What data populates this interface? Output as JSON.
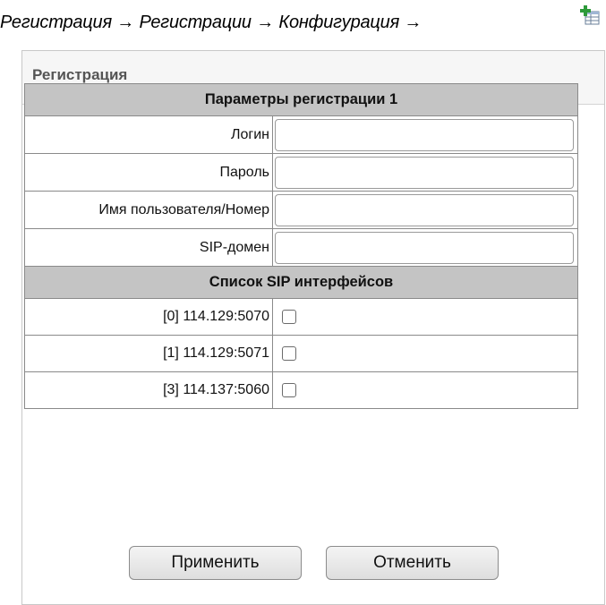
{
  "breadcrumb": {
    "text": "Регистрация → Регистрации → Конфигурация →",
    "icon": "add-table-icon"
  },
  "panel": {
    "title": "Регистрация"
  },
  "form": {
    "section_title": "Параметры регистрации 1",
    "fields": [
      {
        "label": "Логин",
        "value": ""
      },
      {
        "label": "Пароль",
        "value": ""
      },
      {
        "label": "Имя пользователя/Номер",
        "value": ""
      },
      {
        "label": "SIP-домен",
        "value": ""
      }
    ],
    "sip_section_title": "Список SIP интерфейсов",
    "interfaces": [
      {
        "label": "[0] 114.129:5070",
        "checked": false
      },
      {
        "label": "[1] 114.129:5071",
        "checked": false
      },
      {
        "label": "[3] 114.137:5060",
        "checked": false
      }
    ]
  },
  "buttons": {
    "apply": "Применить",
    "cancel": "Отменить"
  },
  "colors": {
    "section_header_bg": "#c4c4c4",
    "panel_header_bg": "#f6f6f6"
  }
}
